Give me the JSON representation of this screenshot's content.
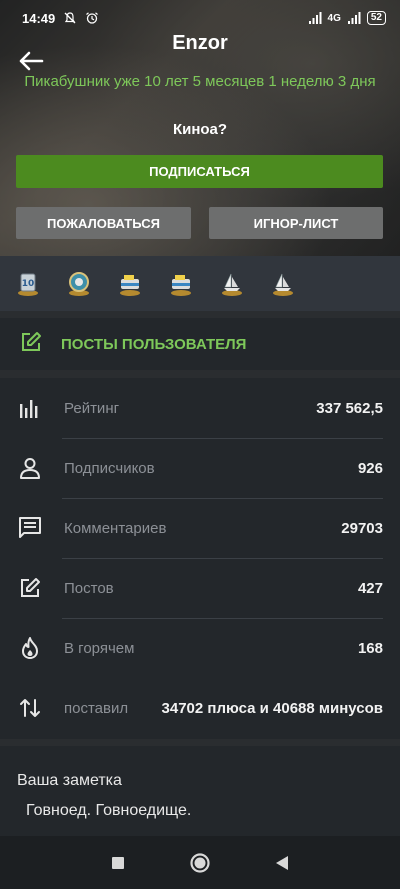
{
  "status_bar": {
    "time": "14:49",
    "network": "4G",
    "battery": "52"
  },
  "profile": {
    "nickname": "Enzor",
    "since": "Пикабушник уже 10 лет 5 месяцев 1 неделю 3 дня",
    "status": "Киноа?"
  },
  "actions": {
    "subscribe": "ПОДПИСАТЬСЯ",
    "report": "ПОЖАЛОВАТЬСЯ",
    "ignore": "ИГНОР-ЛИСТ"
  },
  "awards": [
    "award-10-years-icon",
    "award-medal-icon",
    "award-cake-icon",
    "award-cake-icon",
    "award-ship-icon",
    "award-ship-icon"
  ],
  "posts_link": {
    "label": "ПОСТЫ ПОЛЬЗОВАТЕЛЯ"
  },
  "stats": [
    {
      "icon": "bar-chart-icon",
      "name": "Рейтинг",
      "value": "337 562,5"
    },
    {
      "icon": "person-icon",
      "name": "Подписчиков",
      "value": "926"
    },
    {
      "icon": "comment-icon",
      "name": "Комментариев",
      "value": "29703"
    },
    {
      "icon": "edit-icon",
      "name": "Постов",
      "value": "427"
    },
    {
      "icon": "flame-icon",
      "name": "В горячем",
      "value": "168"
    },
    {
      "icon": "arrows-updown-icon",
      "name": "поставил",
      "value": "34702 плюса и 40688 минусов"
    }
  ],
  "note": {
    "title": "Ваша заметка",
    "text": "Говноед. Говноедище."
  },
  "colors": {
    "accent_green": "#7ec85a",
    "button_green": "#4c8b1f",
    "panel": "#23272b",
    "background": "#2a2d30"
  }
}
